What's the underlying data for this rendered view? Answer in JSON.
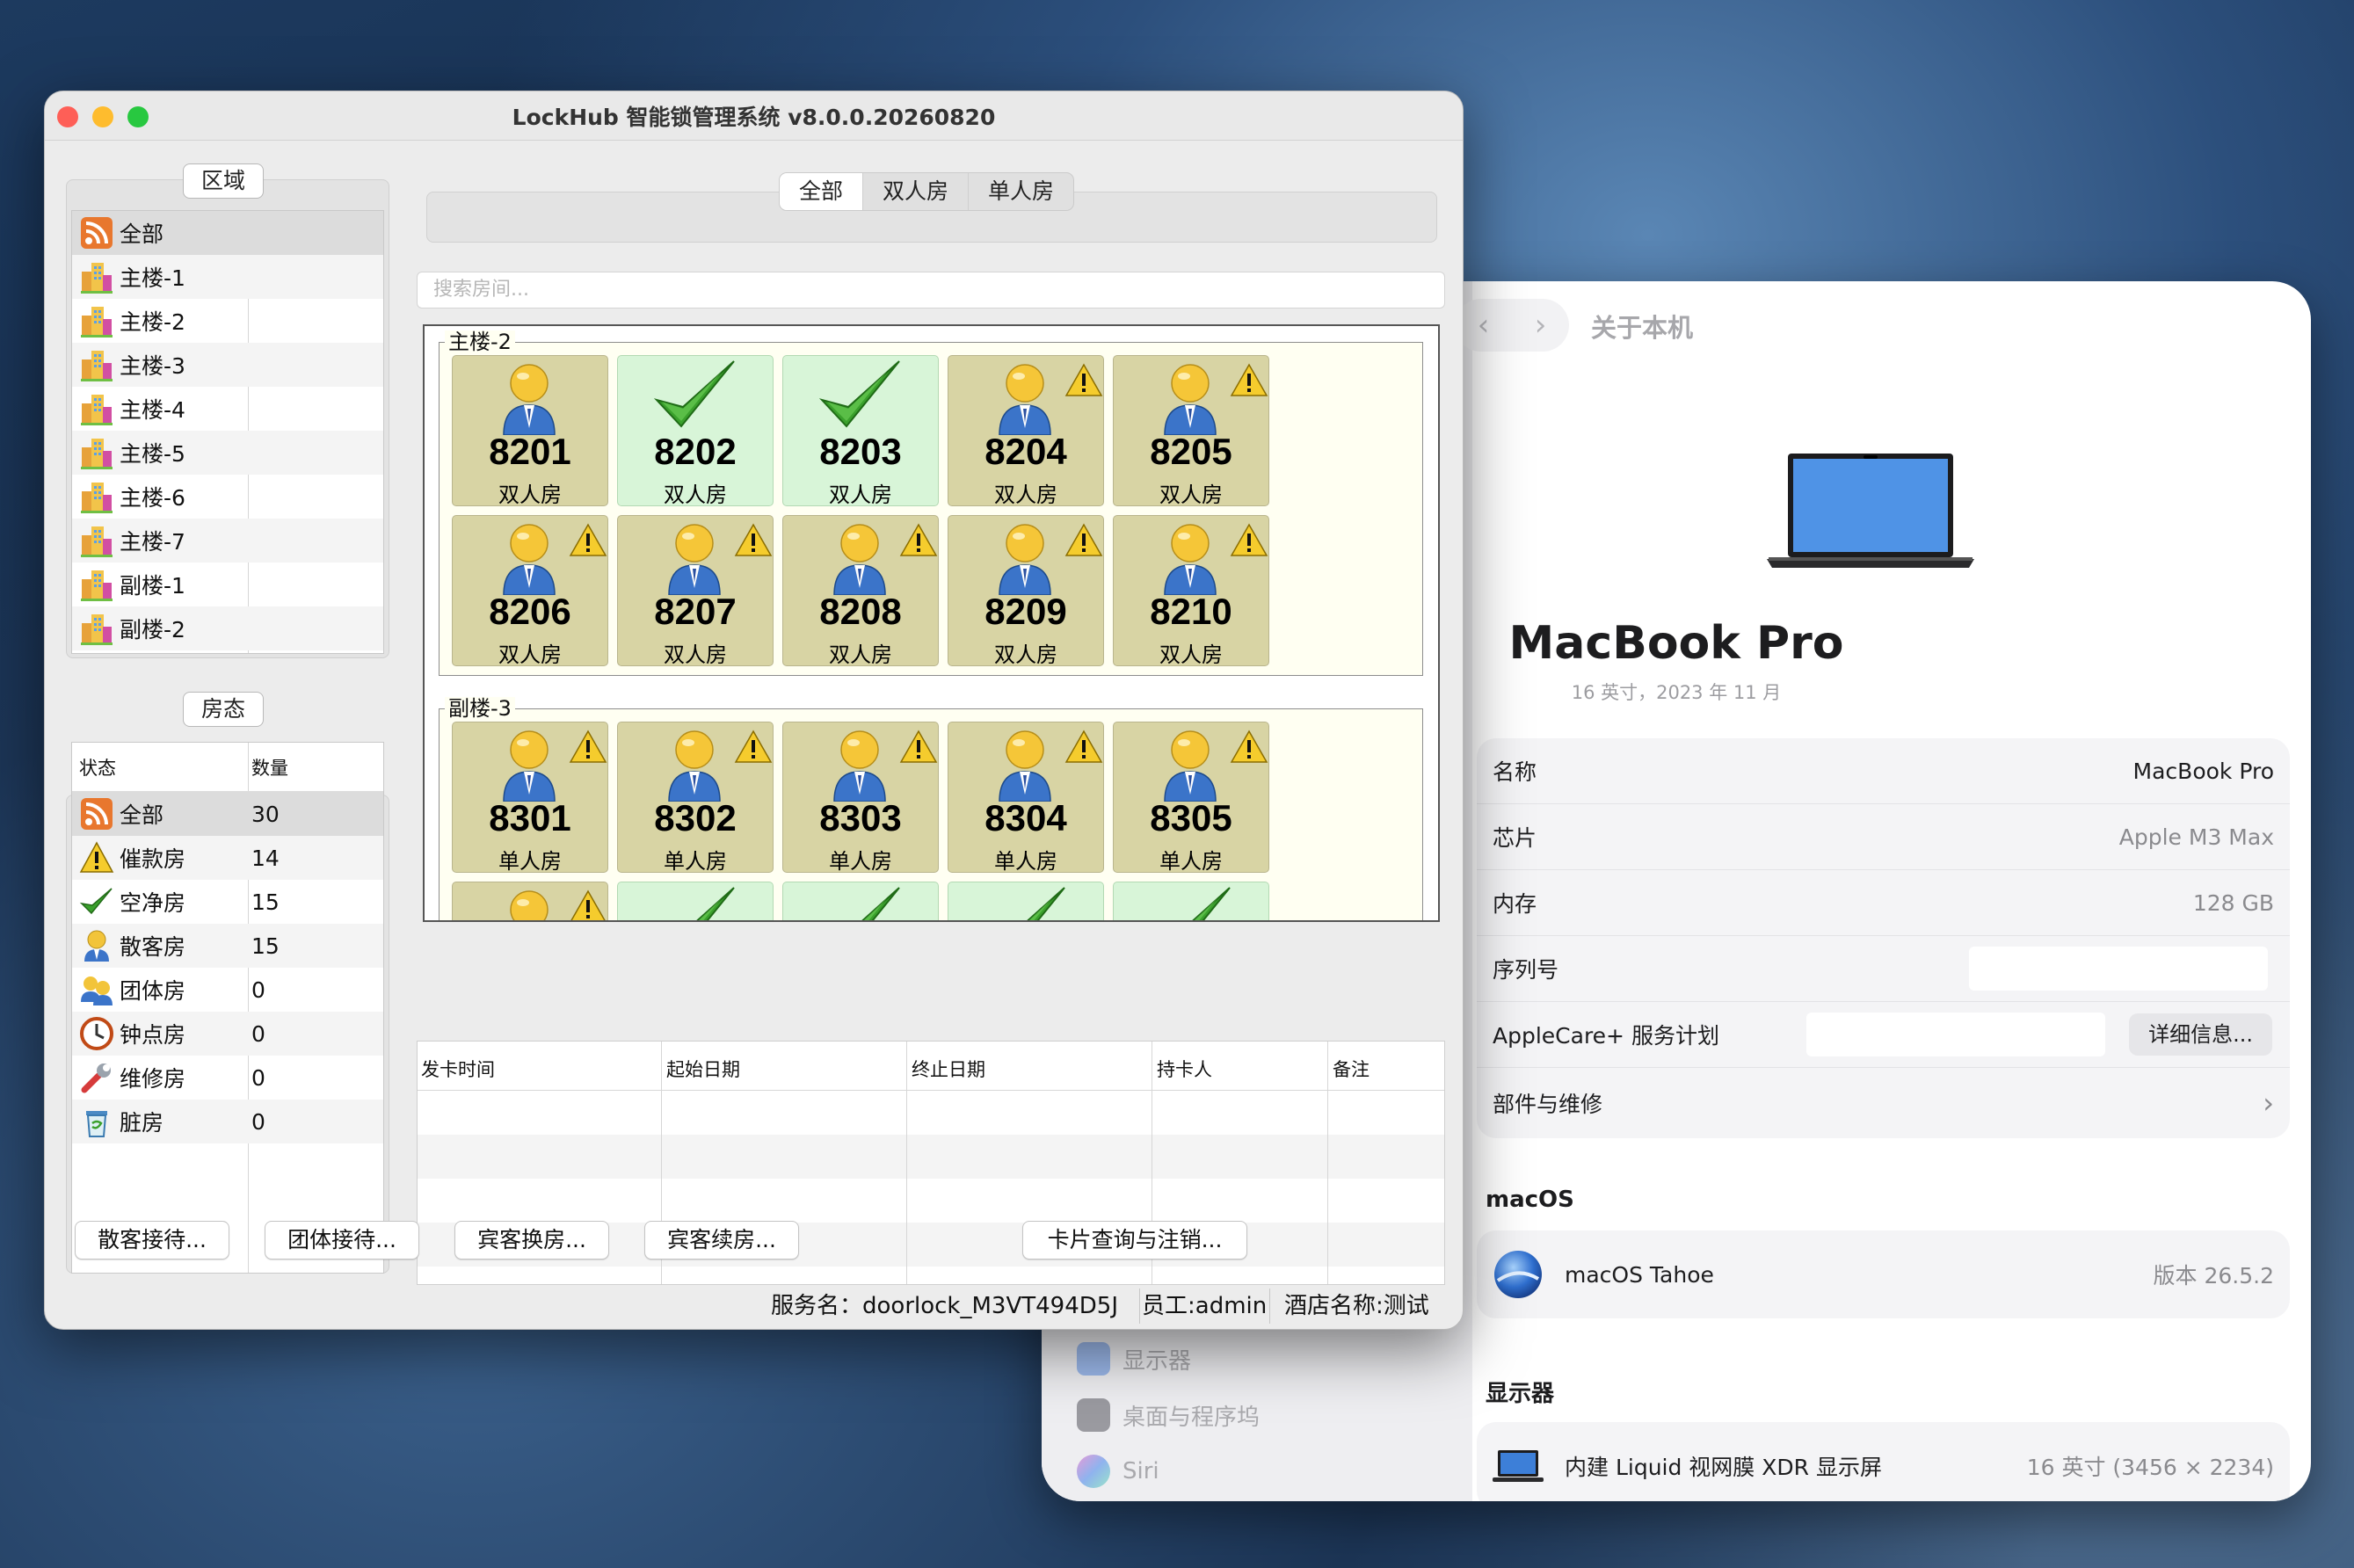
{
  "lockhub": {
    "title": "LockHub 智能锁管理系统 v8.0.0.20260820",
    "area_label": "区域",
    "areas": [
      {
        "label": "全部",
        "icon": "rss-icon"
      },
      {
        "label": "主楼-1",
        "icon": "building-icon"
      },
      {
        "label": "主楼-2",
        "icon": "building-icon"
      },
      {
        "label": "主楼-3",
        "icon": "building-icon"
      },
      {
        "label": "主楼-4",
        "icon": "building-icon"
      },
      {
        "label": "主楼-5",
        "icon": "building-icon"
      },
      {
        "label": "主楼-6",
        "icon": "building-icon"
      },
      {
        "label": "主楼-7",
        "icon": "building-icon"
      },
      {
        "label": "副楼-1",
        "icon": "building-icon"
      },
      {
        "label": "副楼-2",
        "icon": "building-icon"
      }
    ],
    "status_label": "房态",
    "status_headers": {
      "state": "状态",
      "count": "数量"
    },
    "statuses": [
      {
        "label": "全部",
        "count": "30",
        "icon": "rss-icon"
      },
      {
        "label": "催款房",
        "count": "14",
        "icon": "warning-icon"
      },
      {
        "label": "空净房",
        "count": "15",
        "icon": "checkmark-icon"
      },
      {
        "label": "散客房",
        "count": "15",
        "icon": "person-icon"
      },
      {
        "label": "团体房",
        "count": "0",
        "icon": "group-icon"
      },
      {
        "label": "钟点房",
        "count": "0",
        "icon": "clock-icon"
      },
      {
        "label": "维修房",
        "count": "0",
        "icon": "wrench-icon"
      },
      {
        "label": "脏房",
        "count": "0",
        "icon": "trash-icon"
      }
    ],
    "tabs": [
      "全部",
      "双人房",
      "单人房"
    ],
    "search_placeholder": "搜索房间...",
    "groups": [
      {
        "name": "主楼-2",
        "rooms": [
          {
            "number": "8201",
            "type": "双人房",
            "state": "occupied",
            "warn": false
          },
          {
            "number": "8202",
            "type": "双人房",
            "state": "vacant",
            "warn": false
          },
          {
            "number": "8203",
            "type": "双人房",
            "state": "vacant",
            "warn": false
          },
          {
            "number": "8204",
            "type": "双人房",
            "state": "occupied",
            "warn": true
          },
          {
            "number": "8205",
            "type": "双人房",
            "state": "occupied",
            "warn": true
          },
          {
            "number": "8206",
            "type": "双人房",
            "state": "occupied",
            "warn": true
          },
          {
            "number": "8207",
            "type": "双人房",
            "state": "occupied",
            "warn": true
          },
          {
            "number": "8208",
            "type": "双人房",
            "state": "occupied",
            "warn": true
          },
          {
            "number": "8209",
            "type": "双人房",
            "state": "occupied",
            "warn": true
          },
          {
            "number": "8210",
            "type": "双人房",
            "state": "occupied",
            "warn": true
          }
        ]
      },
      {
        "name": "副楼-3",
        "rooms": [
          {
            "number": "8301",
            "type": "单人房",
            "state": "occupied",
            "warn": true
          },
          {
            "number": "8302",
            "type": "单人房",
            "state": "occupied",
            "warn": true
          },
          {
            "number": "8303",
            "type": "单人房",
            "state": "occupied",
            "warn": true
          },
          {
            "number": "8304",
            "type": "单人房",
            "state": "occupied",
            "warn": true
          },
          {
            "number": "8305",
            "type": "单人房",
            "state": "occupied",
            "warn": true
          },
          {
            "number": "",
            "type": "",
            "state": "occupied",
            "warn": true
          },
          {
            "number": "",
            "type": "",
            "state": "vacant",
            "warn": false
          },
          {
            "number": "",
            "type": "",
            "state": "vacant",
            "warn": false
          },
          {
            "number": "",
            "type": "",
            "state": "vacant",
            "warn": false
          },
          {
            "number": "",
            "type": "",
            "state": "vacant",
            "warn": false
          }
        ]
      }
    ],
    "card_table_headers": [
      "发卡时间",
      "起始日期",
      "终止日期",
      "持卡人",
      "备注"
    ],
    "buttons": {
      "walkin": "散客接待...",
      "group": "团体接待...",
      "change": "宾客换房...",
      "extend": "宾客续房...",
      "card_query": "卡片查询与注销..."
    },
    "status_bar": {
      "service": "服务名：doorlock_M3VT494D5J",
      "staff": "员工:admin",
      "hotel": "酒店名称:测试"
    }
  },
  "about": {
    "title": "关于本机",
    "model": "MacBook Pro",
    "subtitle": "16 英寸，2023 年 11 月",
    "specs": [
      {
        "label": "名称",
        "value": "MacBook Pro"
      },
      {
        "label": "芯片",
        "value": "Apple M3 Max"
      },
      {
        "label": "内存",
        "value": "128 GB"
      },
      {
        "label": "序列号",
        "value": ""
      }
    ],
    "applecare_label": "AppleCare+ 服务计划",
    "details_button": "详细信息...",
    "parts_label": "部件与维修",
    "macos_section": "macOS",
    "macos_name": "macOS Tahoe",
    "macos_version": "版本 26.5.2",
    "display_section": "显示器",
    "display_name": "内建 Liquid 视网膜 XDR 显示屏",
    "display_value": "16 英寸 (3456 × 2234)",
    "sidebar_items": [
      "显示器",
      "桌面与程序坞",
      "Siri"
    ]
  }
}
